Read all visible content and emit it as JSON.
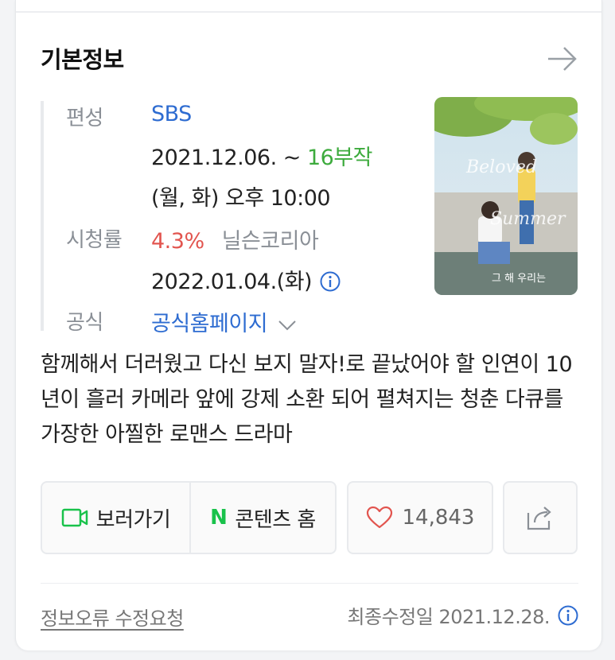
{
  "section": {
    "title": "기본정보"
  },
  "info": {
    "broadcast_label": "편성",
    "broadcast_channel": "SBS",
    "air_start": "2021.12.06. ~ ",
    "episodes": "16부작",
    "air_time": "(월, 화) 오후 10:00",
    "rating_label": "시청률",
    "rating_value": "4.3%",
    "rating_source": "닐슨코리아",
    "rating_date": "2022.01.04.(화)",
    "official_label": "공식",
    "official_link": "공식홈페이지"
  },
  "description": "함께해서 더러웠고 다신 보지 말자!로 끝났어야 할 인연이 10년이 흘러 카메라 앞에 강제 소환 되어 펼쳐지는 청춘 다큐를 가장한 아찔한 로맨스 드라마",
  "actions": {
    "watch_label": "보러가기",
    "content_home_label": "콘텐츠 홈",
    "n_logo": "N",
    "like_count": "14,843"
  },
  "footer": {
    "report_label": "정보오류 수정요청",
    "last_modified": "최종수정일 2021.12.28."
  },
  "colors": {
    "link_blue": "#2e6cd1",
    "episodes_green": "#3dab3d",
    "rating_red": "#e2554f",
    "naver_green": "#19c24b"
  },
  "icons": [
    "arrow-right-icon",
    "info-icon",
    "chevron-down-icon",
    "video-camera-icon",
    "heart-icon",
    "share-icon"
  ]
}
